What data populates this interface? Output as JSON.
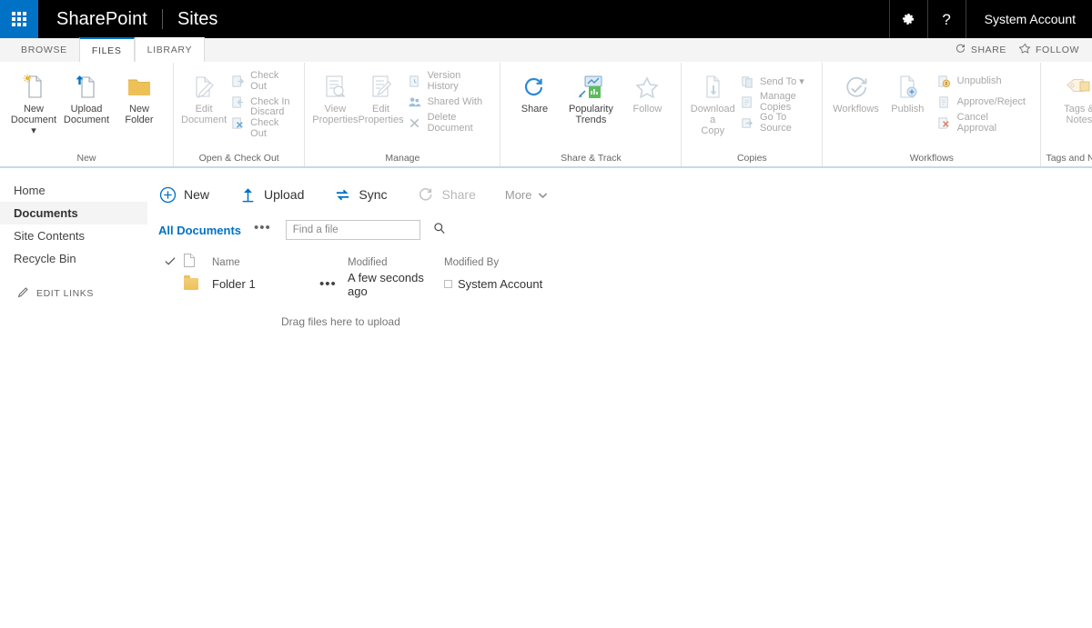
{
  "suite": {
    "app_launcher_icon": "waffle-grid-icon",
    "brand": "SharePoint",
    "site": "Sites",
    "settings_icon": "gear-icon",
    "help_icon": "help-question-icon",
    "user": "System Account"
  },
  "tabs": {
    "items": [
      {
        "label": "BROWSE",
        "active": false
      },
      {
        "label": "FILES",
        "active": true
      },
      {
        "label": "LIBRARY",
        "active": false
      }
    ],
    "share": {
      "label": "SHARE",
      "icon": "share-circle-icon"
    },
    "follow": {
      "label": "FOLLOW",
      "icon": "star-icon"
    }
  },
  "ribbon": {
    "groups": [
      {
        "label": "New",
        "big": [
          {
            "label": "New\nDocument ▾",
            "icon": "new-document-icon",
            "name": "new-document"
          },
          {
            "label": "Upload\nDocument",
            "icon": "upload-document-icon",
            "name": "upload-document"
          },
          {
            "label": "New\nFolder",
            "icon": "new-folder-icon",
            "name": "new-folder"
          }
        ],
        "small": []
      },
      {
        "label": "Open & Check Out",
        "big": [
          {
            "label": "Edit\nDocument",
            "icon": "edit-document-icon",
            "name": "edit-document",
            "dim": true
          }
        ],
        "small": [
          {
            "label": "Check Out",
            "icon": "check-out-icon",
            "name": "check-out",
            "dim": true
          },
          {
            "label": "Check In",
            "icon": "check-in-icon",
            "name": "check-in",
            "dim": true
          },
          {
            "label": "Discard Check Out",
            "icon": "discard-check-out-icon",
            "name": "discard-check-out",
            "dim": true
          }
        ]
      },
      {
        "label": "Manage",
        "big": [
          {
            "label": "View\nProperties",
            "icon": "view-properties-icon",
            "name": "view-properties",
            "dim": true
          },
          {
            "label": "Edit\nProperties",
            "icon": "edit-properties-icon",
            "name": "edit-properties",
            "dim": true
          }
        ],
        "small": [
          {
            "label": "Version History",
            "icon": "version-history-icon",
            "name": "version-history",
            "dim": true
          },
          {
            "label": "Shared With",
            "icon": "shared-with-icon",
            "name": "shared-with",
            "dim": true
          },
          {
            "label": "Delete Document",
            "icon": "delete-document-icon",
            "name": "delete-document",
            "dim": true
          }
        ]
      },
      {
        "label": "Share & Track",
        "big": [
          {
            "label": "Share",
            "icon": "share-icon",
            "name": "share"
          },
          {
            "label": "Popularity\nTrends",
            "icon": "popularity-trends-icon",
            "name": "popularity-trends"
          },
          {
            "label": "Follow",
            "icon": "follow-star-icon",
            "name": "follow",
            "dim": true
          }
        ],
        "small": []
      },
      {
        "label": "Copies",
        "big": [
          {
            "label": "Download a\nCopy",
            "icon": "download-copy-icon",
            "name": "download-a-copy",
            "dim": true
          }
        ],
        "small": [
          {
            "label": "Send To ▾",
            "icon": "send-to-icon",
            "name": "send-to",
            "dim": true
          },
          {
            "label": "Manage Copies",
            "icon": "manage-copies-icon",
            "name": "manage-copies",
            "dim": true
          },
          {
            "label": "Go To Source",
            "icon": "go-to-source-icon",
            "name": "go-to-source",
            "dim": true
          }
        ]
      },
      {
        "label": "Workflows",
        "big": [
          {
            "label": "Workflows",
            "icon": "workflows-icon",
            "name": "workflows",
            "dim": true
          },
          {
            "label": "Publish",
            "icon": "publish-icon",
            "name": "publish",
            "dim": true
          }
        ],
        "small": [
          {
            "label": "Unpublish",
            "icon": "unpublish-icon",
            "name": "unpublish",
            "dim": true
          },
          {
            "label": "Approve/Reject",
            "icon": "approve-reject-icon",
            "name": "approve-reject",
            "dim": true
          },
          {
            "label": "Cancel Approval",
            "icon": "cancel-approval-icon",
            "name": "cancel-approval",
            "dim": true
          }
        ]
      },
      {
        "label": "Tags and Notes",
        "big": [
          {
            "label": "Tags &\nNotes",
            "icon": "tags-notes-icon",
            "name": "tags-and-notes",
            "dim": true
          }
        ],
        "small": []
      }
    ]
  },
  "sidebar": {
    "items": [
      {
        "label": "Home",
        "active": false
      },
      {
        "label": "Documents",
        "active": true
      },
      {
        "label": "Site Contents",
        "active": false
      },
      {
        "label": "Recycle Bin",
        "active": false
      }
    ],
    "edit_links": {
      "label": "EDIT LINKS",
      "icon": "pencil-icon"
    }
  },
  "command_bar": {
    "items": [
      {
        "label": "New",
        "icon": "plus-circle-icon",
        "name": "new",
        "disabled": false
      },
      {
        "label": "Upload",
        "icon": "upload-arrow-icon",
        "name": "upload",
        "disabled": false
      },
      {
        "label": "Sync",
        "icon": "sync-arrows-icon",
        "name": "sync",
        "disabled": false
      },
      {
        "label": "Share",
        "icon": "share-circle-icon",
        "name": "share",
        "disabled": true
      }
    ],
    "more": {
      "label": "More",
      "icon": "chevron-down-icon"
    }
  },
  "view_bar": {
    "current_view": "All Documents",
    "ellipsis": "•••",
    "search_placeholder": "Find a file",
    "search_value": "",
    "search_icon": "search-magnifier-icon"
  },
  "file_list": {
    "columns": [
      "",
      "",
      "Name",
      "",
      "Modified",
      "Modified By"
    ],
    "select_all_icon": "checkmark-icon",
    "type_icon": "document-type-icon",
    "rows": [
      {
        "icon": "folder-icon",
        "name": "Folder 1",
        "dots": "•••",
        "modified": "A few seconds ago",
        "modified_by": "System Account",
        "presence_icon": "presence-offline-icon"
      }
    ],
    "drag_hint": "Drag files here to upload"
  },
  "colors": {
    "brand_blue": "#0072C6",
    "suite_bar_bg": "#000000",
    "ribbon_underline": "#c6d9ea",
    "nav_active_bg": "#f4f4f4",
    "folder_amber": "#eec158",
    "muted_text": "#767676"
  }
}
